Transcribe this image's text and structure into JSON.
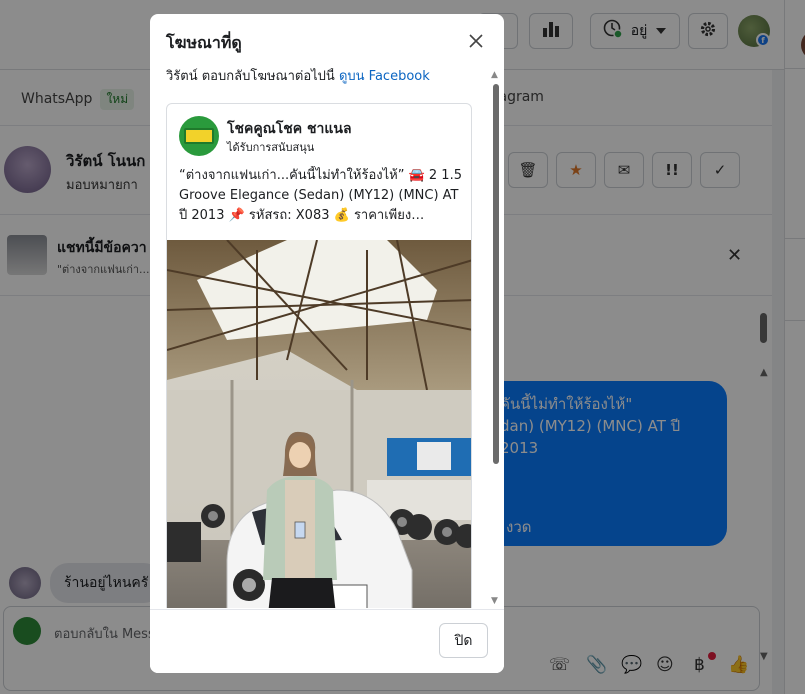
{
  "topbar": {
    "status_label": "อยู่"
  },
  "tabs": {
    "whatsapp_label": "WhatsApp",
    "whatsapp_badge": "ใหม่",
    "instagram_partial": "tagram"
  },
  "contact": {
    "name_partial": "วิรัตน์ โนนก",
    "sub_partial": "มอบหมายกา"
  },
  "banner": {
    "title_partial": "แชทนี้มีข้อควา",
    "sub_partial": "\"ต่างจากแฟนเก่า..."
  },
  "chat": {
    "outgoing_lines": [
      "คันนี้ไม่ทำให้ร้องไห้\"",
      "dan) (MY12) (MNC) AT ปี 2013"
    ],
    "outgoing_footer": "งวด",
    "incoming_partial": "ร้านอยู่ไหนครั"
  },
  "composer": {
    "placeholder_partial": "ตอบกลับใน Mess"
  },
  "modal": {
    "title": "โฆษณาที่ดู",
    "reply_prefix": "วิรัตน์ ตอบกลับโฆษณาต่อไปนี้ ",
    "reply_link": "ดูบน Facebook",
    "ad": {
      "page_name": "โชคคูณโชค ชาแนล",
      "sponsored": "ได้รับการสนับสนุน",
      "text": "“ต่างจากแฟนเก่า...คันนี้ไม่ทำให้ร้องไห้” 🚘 2 1.5 Groove Elegance (Sedan) (MY12) (MNC) AT ปี 2013 📌 รหัสรถ: X083 💰 ราคาเพียง…"
    },
    "close_label": "ปิด"
  }
}
